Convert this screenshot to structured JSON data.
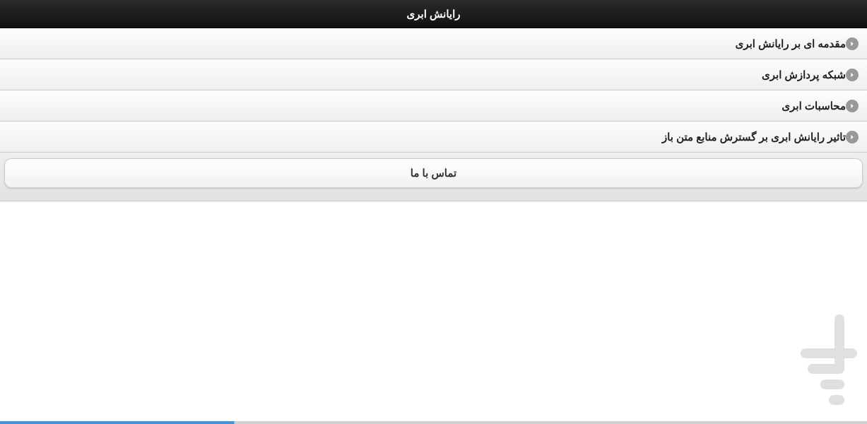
{
  "header": {
    "title": "رایانش ابری"
  },
  "list": {
    "items": [
      {
        "label": "مقدمه ای بر رایانش ابری"
      },
      {
        "label": "شبکه پردازش ابری"
      },
      {
        "label": "محاسبات ابری"
      },
      {
        "label": "تاثیر رایانش ابری بر گسترش منابع متن باز"
      }
    ]
  },
  "contact_button": {
    "label": "تماس با ما"
  }
}
